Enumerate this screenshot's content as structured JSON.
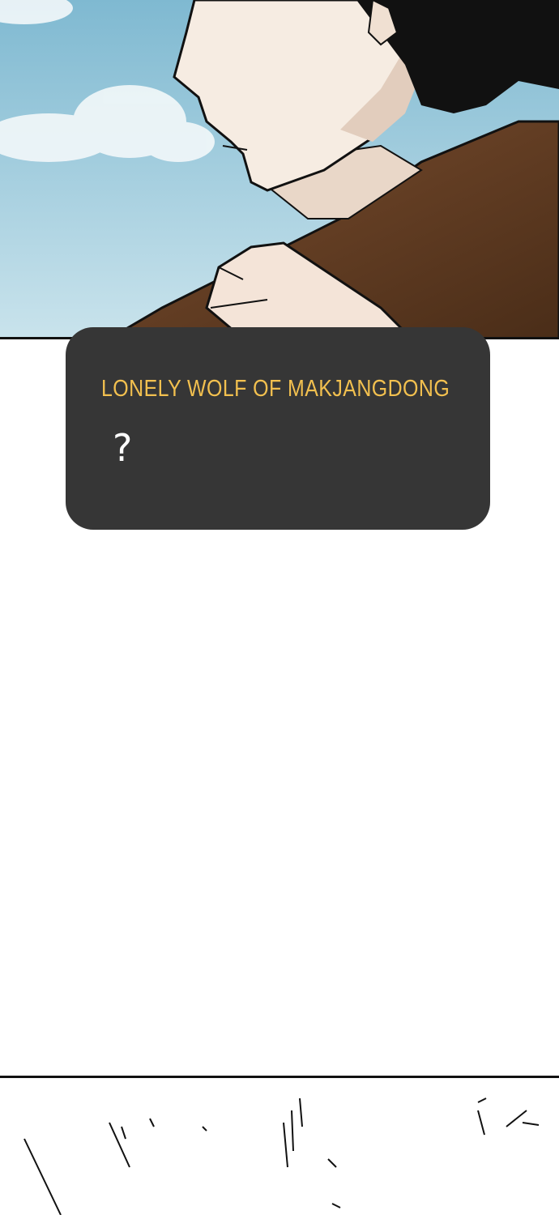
{
  "caption": {
    "speaker": "LONELY WOLF OF MAKJANGDONG",
    "line": "?"
  },
  "colors": {
    "sky": "#8ec6dc",
    "jacket": "#6b4328",
    "skin": "#f6ece2",
    "hair": "#111111",
    "caption_bg": "#363636",
    "caption_title": "#f2c04f"
  }
}
